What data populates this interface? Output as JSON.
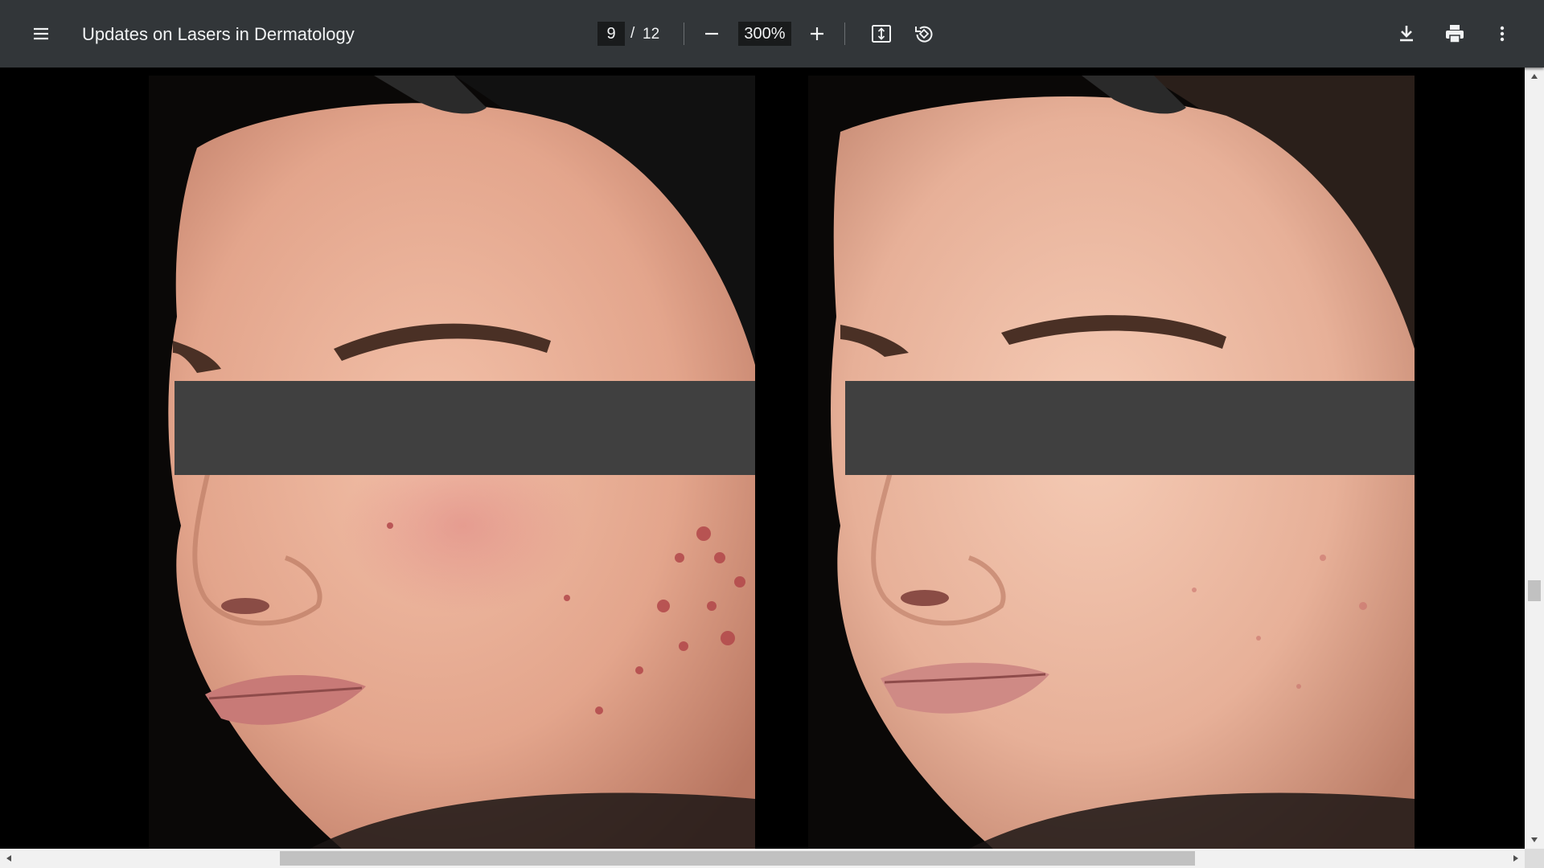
{
  "toolbar": {
    "menu_icon": "hamburger-menu-icon",
    "title": "Updates on Lasers in Dermatology",
    "current_page": "9",
    "page_separator": "/",
    "total_pages": "12",
    "zoom_out_icon": "minus-icon",
    "zoom_level": "300%",
    "zoom_in_icon": "plus-icon",
    "fit_icon": "fit-to-page-icon",
    "rotate_icon": "rotate-counterclockwise-icon",
    "download_icon": "download-icon",
    "print_icon": "print-icon",
    "more_icon": "more-vert-icon"
  },
  "document": {
    "images": [
      "face-before-treatment",
      "face-after-treatment"
    ]
  },
  "colors": {
    "toolbar_bg": "#323639",
    "input_bg": "#191b1c",
    "viewer_bg": "#000000",
    "censor_bar": "#404040",
    "scrollbar_track": "#f1f1f1",
    "scrollbar_thumb": "#c1c1c1"
  },
  "scroll": {
    "vertical_position_fraction": 0.66,
    "horizontal_visible_fraction": 0.6
  }
}
